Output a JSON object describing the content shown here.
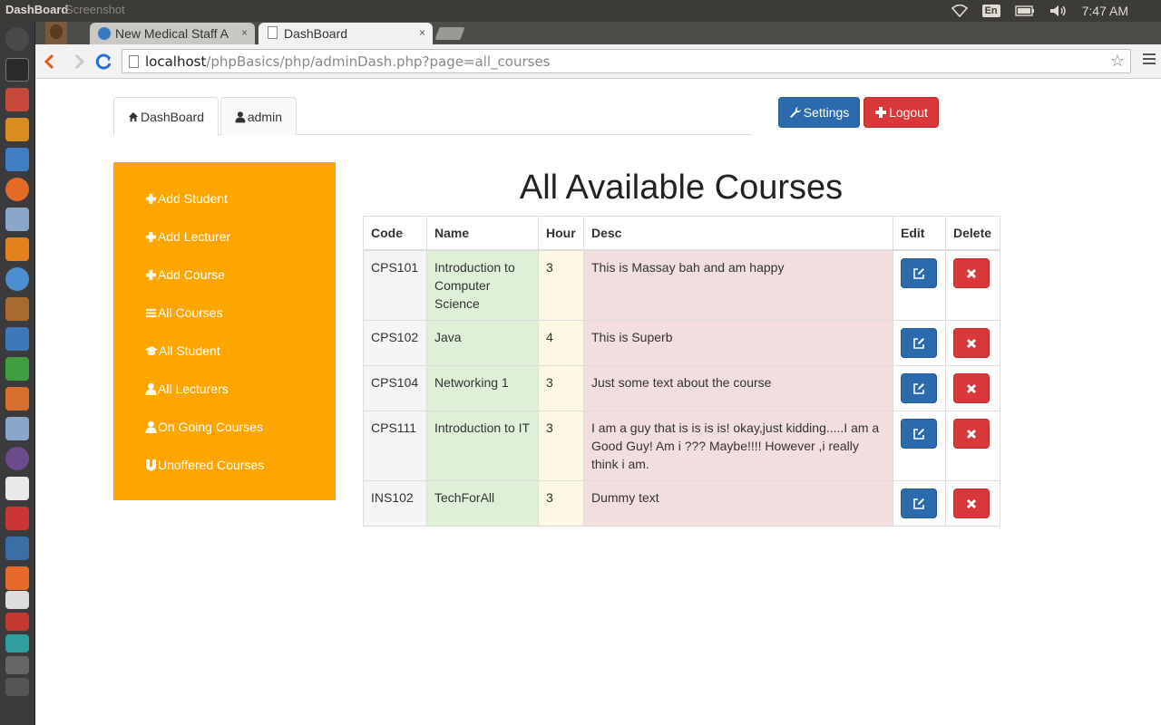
{
  "system_panel": {
    "window_title": "DashBoard",
    "ghost_title": "Screenshot",
    "language": "En",
    "clock": "7:47 AM"
  },
  "browser": {
    "tabs": [
      {
        "label": "New Medical Staff A"
      },
      {
        "label": "DashBoard"
      }
    ],
    "tab_close": "×",
    "url_host": "localhost",
    "url_path": "/phpBasics/php/adminDash.php?page=all_courses"
  },
  "nav": {
    "dashboard_tab": "DashBoard",
    "admin_tab": "admin",
    "settings_button": "Settings",
    "logout_button": "Logout"
  },
  "sidebar": {
    "items": [
      {
        "label": "Add Student",
        "icon": "plus-icon"
      },
      {
        "label": "Add Lecturer",
        "icon": "plus-icon"
      },
      {
        "label": "Add Course",
        "icon": "plus-icon"
      },
      {
        "label": "All Courses",
        "icon": "list-icon"
      },
      {
        "label": "All Student",
        "icon": "graduation-cap-icon"
      },
      {
        "label": "All Lecturers",
        "icon": "user-icon"
      },
      {
        "label": "On Going Courses",
        "icon": "user-icon"
      },
      {
        "label": "Unoffered Courses",
        "icon": "magnet-icon"
      }
    ]
  },
  "main": {
    "heading": "All Available Courses",
    "columns": [
      "Code",
      "Name",
      "Hour",
      "Desc",
      "Edit",
      "Delete"
    ],
    "rows": [
      {
        "code": "CPS101",
        "name": "Introduction to Computer Science",
        "hour": "3",
        "desc": "This is Massay bah and am happy"
      },
      {
        "code": "CPS102",
        "name": "Java",
        "hour": "4",
        "desc": "This is Superb"
      },
      {
        "code": "CPS104",
        "name": "Networking 1",
        "hour": "3",
        "desc": "Just some text about the course"
      },
      {
        "code": "CPS111",
        "name": "Introduction to IT",
        "hour": "3",
        "desc": "I am a guy that is is is is! okay,just kidding.....I am a Good Guy! Am i ??? Maybe!!!! However ,i really think i am."
      },
      {
        "code": "INS102",
        "name": "TechForAll",
        "hour": "3",
        "desc": "Dummy text"
      }
    ]
  },
  "colors": {
    "sidebar_bg": "#ffa500",
    "primary": "#2a6aad",
    "danger": "#d9383b",
    "name_col": "#dff0d8",
    "hour_col": "#fcf8e3",
    "desc_col": "#f2dede"
  }
}
